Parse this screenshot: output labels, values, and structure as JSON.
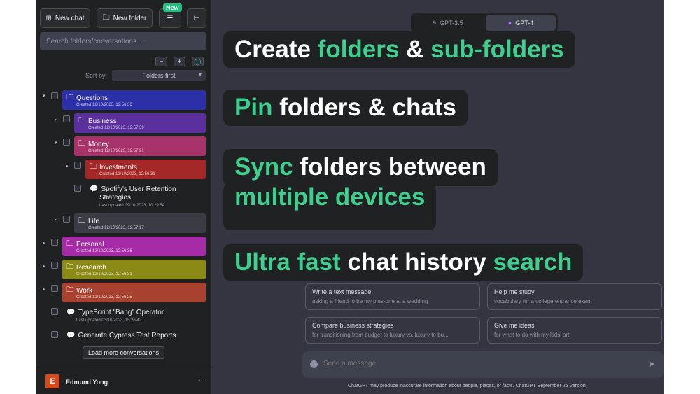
{
  "sidebar": {
    "new_chat": "New chat",
    "new_folder": "New folder",
    "new_badge": "New",
    "menu_icon": "☰",
    "collapse_icon": "⊢",
    "search_placeholder": "Search folders/conversations...",
    "minus": "−",
    "plus": "+",
    "sort_label": "Sort by:",
    "sort_value": "Folders first",
    "folders": [
      {
        "name": "Questions",
        "created": "Created 12/10/2023, 12:56:36",
        "color": "#2b2fa8"
      },
      {
        "name": "Business",
        "created": "Created 12/10/2023, 12:57:39",
        "color": "#5b2f9e"
      },
      {
        "name": "Money",
        "created": "Created 12/10/2023, 12:57:21",
        "color": "#a8336b"
      },
      {
        "name": "Investments",
        "created": "Created 12/10/2023, 12:56:31",
        "color": "#a42828"
      },
      {
        "name": "Life",
        "created": "Created 12/10/2023, 12:57:17",
        "color": "#3a3b45"
      },
      {
        "name": "Personal",
        "created": "Created 12/10/2023, 12:56:36",
        "color": "#a62ba6"
      },
      {
        "name": "Research",
        "created": "Created 12/10/2023, 12:56:31",
        "color": "#8c8a17"
      },
      {
        "name": "Work",
        "created": "Created 12/10/2023, 12:56:25",
        "color": "#a8412f"
      }
    ],
    "chats": [
      {
        "title": "Spotify's User Retention",
        "title2": "Strategies",
        "updated": "Last updated 09/10/2023, 10:29:54"
      },
      {
        "title": "TypeScript \"Bang\" Operator",
        "updated": "Last updated 03/10/2023, 15:26:42"
      },
      {
        "title": "Generate Cypress Test Reports",
        "updated": ""
      }
    ],
    "load_more": "Load more conversations",
    "user_initial": "E",
    "user_name": "Edmund Yong",
    "user_more": "···"
  },
  "main": {
    "model_gpt35": "GPT-3.5",
    "model_gpt4": "GPT-4",
    "features": {
      "f1": {
        "a": "Create ",
        "b": "folders",
        "c": " & ",
        "d": "sub-folders"
      },
      "f2": {
        "a": "Pin",
        "b": " folders & chats"
      },
      "f3": {
        "a": "Sync",
        "b": " folders between",
        "c": "multiple devices"
      },
      "f4": {
        "a": "Ultra fast",
        "b": " chat history ",
        "c": "search"
      }
    },
    "suggestions": [
      {
        "title": "Write a text message",
        "desc": "asking a friend to be my plus-one at a wedding"
      },
      {
        "title": "Help me study",
        "desc": "vocabulary for a college entrance exam"
      },
      {
        "title": "Compare business strategies",
        "desc": "for transitioning from budget to luxury vs. luxury to bu..."
      },
      {
        "title": "Give me ideas",
        "desc": "for what to do with my kids' art"
      }
    ],
    "message_placeholder": "Send a message",
    "footer_text": "ChatGPT may produce inaccurate information about people, places, or facts. ",
    "footer_link": "ChatGPT September 25 Version"
  },
  "colors": {
    "accent": "#3ecf8e",
    "sidebar_bg": "#202123",
    "main_bg": "#343541"
  }
}
